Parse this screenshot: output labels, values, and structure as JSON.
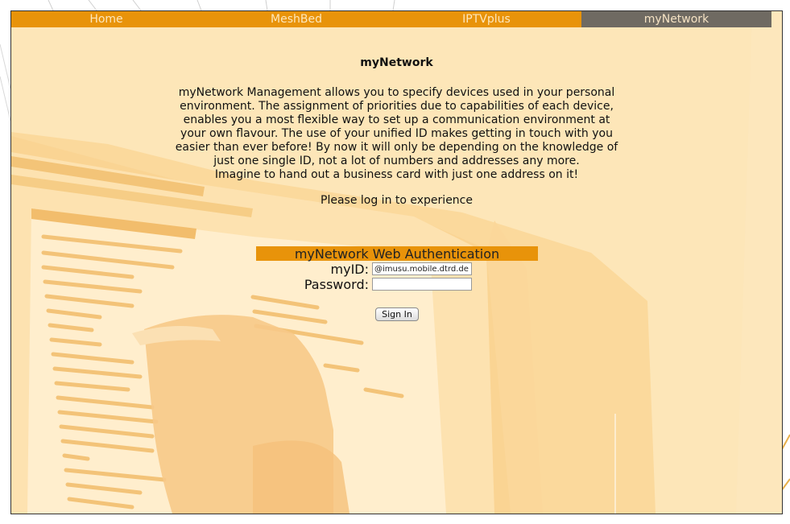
{
  "nav": {
    "items": [
      {
        "label": "Home",
        "active": false
      },
      {
        "label": "MeshBed",
        "active": false
      },
      {
        "label": "IPTVplus",
        "active": false
      },
      {
        "label": "myNetwork",
        "active": true
      }
    ]
  },
  "main": {
    "title": "myNetwork",
    "description_lines": [
      "myNetwork Management allows you to specify devices used in your personal",
      "environment. The assignment of priorities due to capabilities of each device,",
      "enables you a most flexible way to set up a communication environment at",
      "your own flavour. The use of your unified ID makes getting in touch with you",
      "easier than ever before! By now it will only be depending on the knowledge of",
      "just one single ID, not a lot of numbers and addresses any more.",
      "Imagine to hand out a business card with just one address on it!"
    ],
    "prompt": "Please log in to experience"
  },
  "auth": {
    "header": "myNetwork Web Authentication",
    "myid_label": "myID:",
    "myid_value": "@imusu.mobile.dtrd.de",
    "password_label": "Password:",
    "password_value": "",
    "signin_label": "Sign In"
  },
  "colors": {
    "accent": "#e8930a",
    "active_tab": "#6f6a62",
    "background": "#fde6b8"
  }
}
